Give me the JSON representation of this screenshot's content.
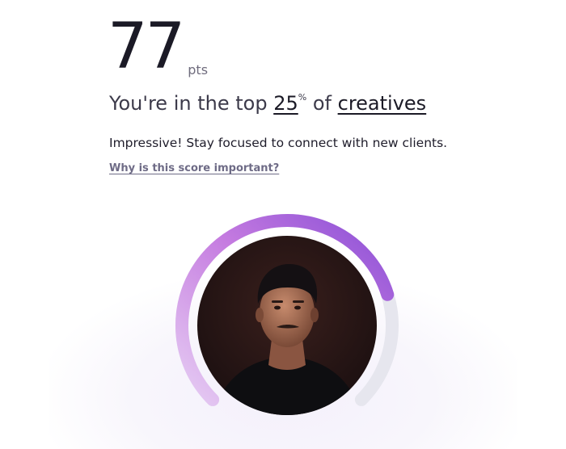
{
  "score": {
    "value": "77",
    "unit": "pts"
  },
  "rank": {
    "prefix": "You're in the top",
    "percent": "25",
    "percent_sign": "%",
    "joiner": "of",
    "category": "creatives"
  },
  "message": "Impressive! Stay focused to connect with new clients.",
  "why_link": "Why is this score important?",
  "gauge": {
    "progress": 0.77,
    "track_color": "#e6e6ee",
    "gradient_start": "#e6cdf3",
    "gradient_mid": "#c57be0",
    "gradient_end": "#8a4fd6"
  },
  "avatar": {
    "icon": "profile-photo"
  }
}
